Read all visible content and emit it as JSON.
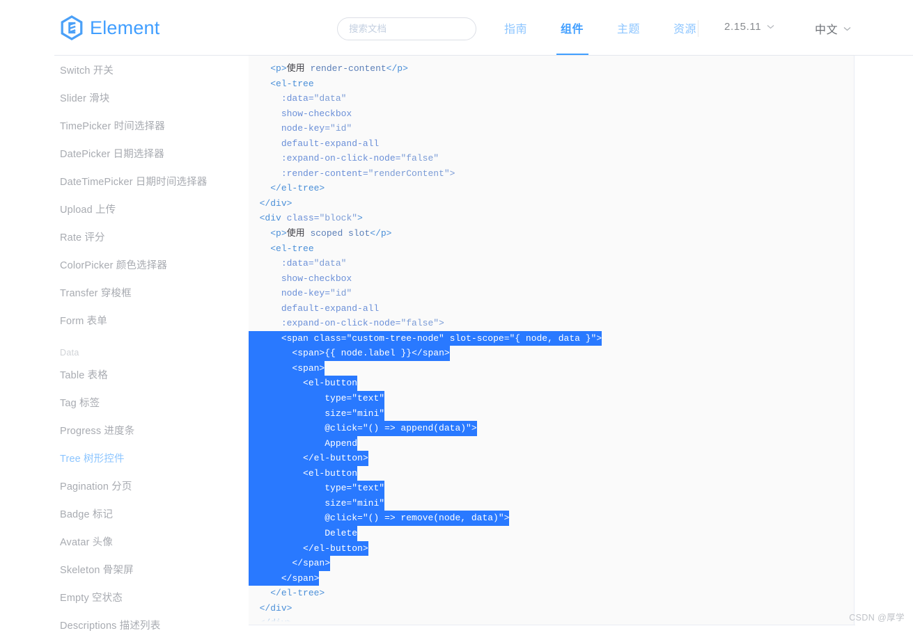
{
  "brand": {
    "name": "Element",
    "logo_icon": "element-hexagon-logo-icon",
    "accent_color": "#409eff"
  },
  "header": {
    "search": {
      "placeholder": "搜索文档",
      "value": "",
      "icon": "search-icon"
    },
    "nav": [
      {
        "label": "指南",
        "active": false
      },
      {
        "label": "组件",
        "active": true
      },
      {
        "label": "主题",
        "active": false
      },
      {
        "label": "资源",
        "active": false
      }
    ],
    "version": {
      "label": "2.15.11",
      "icon": "chevron-down-icon"
    },
    "language": {
      "label": "中文",
      "icon": "chevron-down-icon"
    }
  },
  "sidebar": {
    "items": [
      {
        "label": "Switch 开关",
        "type": "item",
        "active": false
      },
      {
        "label": "Slider 滑块",
        "type": "item",
        "active": false
      },
      {
        "label": "TimePicker 时间选择器",
        "type": "item",
        "active": false
      },
      {
        "label": "DatePicker 日期选择器",
        "type": "item",
        "active": false
      },
      {
        "label": "DateTimePicker 日期时间选择器",
        "type": "item",
        "active": false
      },
      {
        "label": "Upload 上传",
        "type": "item",
        "active": false
      },
      {
        "label": "Rate 评分",
        "type": "item",
        "active": false
      },
      {
        "label": "ColorPicker 颜色选择器",
        "type": "item",
        "active": false
      },
      {
        "label": "Transfer 穿梭框",
        "type": "item",
        "active": false
      },
      {
        "label": "Form 表单",
        "type": "item",
        "active": false
      },
      {
        "label": "Data",
        "type": "group",
        "active": false
      },
      {
        "label": "Table 表格",
        "type": "item",
        "active": false
      },
      {
        "label": "Tag 标签",
        "type": "item",
        "active": false
      },
      {
        "label": "Progress 进度条",
        "type": "item",
        "active": false
      },
      {
        "label": "Tree 树形控件",
        "type": "item",
        "active": true
      },
      {
        "label": "Pagination 分页",
        "type": "item",
        "active": false
      },
      {
        "label": "Badge 标记",
        "type": "item",
        "active": false
      },
      {
        "label": "Avatar 头像",
        "type": "item",
        "active": false
      },
      {
        "label": "Skeleton 骨架屏",
        "type": "item",
        "active": false
      },
      {
        "label": "Empty 空状态",
        "type": "item",
        "active": false
      },
      {
        "label": "Descriptions 描述列表",
        "type": "item",
        "active": false
      }
    ]
  },
  "code_block": {
    "language": "html",
    "selection_color": "#2979ff",
    "background": "#fafafa",
    "lines": [
      {
        "indent": 2,
        "selected": false,
        "tokens": [
          {
            "t": "tag",
            "s": "<p>"
          },
          {
            "t": "han",
            "s": "使用"
          },
          {
            "t": "han",
            "s": " "
          },
          {
            "t": "pln",
            "s": "render-content"
          },
          {
            "t": "tag",
            "s": "</p>"
          }
        ]
      },
      {
        "indent": 2,
        "selected": false,
        "tokens": [
          {
            "t": "tag",
            "s": "<el-tree"
          }
        ]
      },
      {
        "indent": 3,
        "selected": false,
        "tokens": [
          {
            "t": "attr",
            "s": ":data="
          },
          {
            "t": "val",
            "s": "\"data\""
          }
        ]
      },
      {
        "indent": 3,
        "selected": false,
        "tokens": [
          {
            "t": "attr",
            "s": "show-checkbox"
          }
        ]
      },
      {
        "indent": 3,
        "selected": false,
        "tokens": [
          {
            "t": "attr",
            "s": "node-key="
          },
          {
            "t": "val",
            "s": "\"id\""
          }
        ]
      },
      {
        "indent": 3,
        "selected": false,
        "tokens": [
          {
            "t": "attr",
            "s": "default-expand-all"
          }
        ]
      },
      {
        "indent": 3,
        "selected": false,
        "tokens": [
          {
            "t": "attr",
            "s": ":expand-on-click-node="
          },
          {
            "t": "val",
            "s": "\"false\""
          }
        ]
      },
      {
        "indent": 3,
        "selected": false,
        "tokens": [
          {
            "t": "attr",
            "s": ":render-content="
          },
          {
            "t": "val",
            "s": "\"renderContent\">"
          }
        ]
      },
      {
        "indent": 2,
        "selected": false,
        "tokens": [
          {
            "t": "tag",
            "s": "</el-tree>"
          }
        ]
      },
      {
        "indent": 1,
        "selected": false,
        "tokens": [
          {
            "t": "tag",
            "s": "</div>"
          }
        ]
      },
      {
        "indent": 1,
        "selected": false,
        "tokens": [
          {
            "t": "tag",
            "s": "<div "
          },
          {
            "t": "attr",
            "s": "class="
          },
          {
            "t": "val",
            "s": "\"block\""
          },
          {
            "t": "tag",
            "s": ">"
          }
        ]
      },
      {
        "indent": 2,
        "selected": false,
        "tokens": [
          {
            "t": "tag",
            "s": "<p>"
          },
          {
            "t": "han",
            "s": "使用"
          },
          {
            "t": "han",
            "s": " "
          },
          {
            "t": "pln",
            "s": "scoped slot"
          },
          {
            "t": "tag",
            "s": "</p>"
          }
        ]
      },
      {
        "indent": 2,
        "selected": false,
        "tokens": [
          {
            "t": "tag",
            "s": "<el-tree"
          }
        ]
      },
      {
        "indent": 3,
        "selected": false,
        "tokens": [
          {
            "t": "attr",
            "s": ":data="
          },
          {
            "t": "val",
            "s": "\"data\""
          }
        ]
      },
      {
        "indent": 3,
        "selected": false,
        "tokens": [
          {
            "t": "attr",
            "s": "show-checkbox"
          }
        ]
      },
      {
        "indent": 3,
        "selected": false,
        "tokens": [
          {
            "t": "attr",
            "s": "node-key="
          },
          {
            "t": "val",
            "s": "\"id\""
          }
        ]
      },
      {
        "indent": 3,
        "selected": false,
        "tokens": [
          {
            "t": "attr",
            "s": "default-expand-all"
          }
        ]
      },
      {
        "indent": 3,
        "selected": false,
        "tokens": [
          {
            "t": "attr",
            "s": ":expand-on-click-node="
          },
          {
            "t": "val",
            "s": "\"false\">"
          }
        ]
      },
      {
        "indent": 3,
        "selected": true,
        "first": true,
        "tokens": [
          {
            "t": "tag",
            "s": "<span "
          },
          {
            "t": "attr",
            "s": "class="
          },
          {
            "t": "val",
            "s": "\"custom-tree-node\""
          },
          {
            "t": "attr",
            "s": " slot-scope="
          },
          {
            "t": "val",
            "s": "\"{ node, data }\""
          },
          {
            "t": "tag",
            "s": ">"
          }
        ]
      },
      {
        "indent": 4,
        "selected": true,
        "tokens": [
          {
            "t": "tag",
            "s": "<span>"
          },
          {
            "t": "pln",
            "s": "{{ node.label }}"
          },
          {
            "t": "tag",
            "s": "</span>"
          }
        ]
      },
      {
        "indent": 4,
        "selected": true,
        "tokens": [
          {
            "t": "tag",
            "s": "<span>"
          }
        ]
      },
      {
        "indent": 5,
        "selected": true,
        "tokens": [
          {
            "t": "tag",
            "s": "<el-button"
          }
        ]
      },
      {
        "indent": 7,
        "selected": true,
        "tokens": [
          {
            "t": "attr",
            "s": "type="
          },
          {
            "t": "val",
            "s": "\"text\""
          }
        ]
      },
      {
        "indent": 7,
        "selected": true,
        "tokens": [
          {
            "t": "attr",
            "s": "size="
          },
          {
            "t": "val",
            "s": "\"mini\""
          }
        ]
      },
      {
        "indent": 7,
        "selected": true,
        "tokens": [
          {
            "t": "attr",
            "s": "@click="
          },
          {
            "t": "val",
            "s": "\"() => append(data)\""
          },
          {
            "t": "tag",
            "s": ">"
          }
        ]
      },
      {
        "indent": 7,
        "selected": true,
        "tokens": [
          {
            "t": "pln",
            "s": "Append"
          }
        ]
      },
      {
        "indent": 5,
        "selected": true,
        "tokens": [
          {
            "t": "tag",
            "s": "</el-button>"
          }
        ]
      },
      {
        "indent": 5,
        "selected": true,
        "tokens": [
          {
            "t": "tag",
            "s": "<el-button"
          }
        ]
      },
      {
        "indent": 7,
        "selected": true,
        "tokens": [
          {
            "t": "attr",
            "s": "type="
          },
          {
            "t": "val",
            "s": "\"text\""
          }
        ]
      },
      {
        "indent": 7,
        "selected": true,
        "tokens": [
          {
            "t": "attr",
            "s": "size="
          },
          {
            "t": "val",
            "s": "\"mini\""
          }
        ]
      },
      {
        "indent": 7,
        "selected": true,
        "tokens": [
          {
            "t": "attr",
            "s": "@click="
          },
          {
            "t": "val",
            "s": "\"() => remove(node, data)\""
          },
          {
            "t": "tag",
            "s": ">"
          }
        ]
      },
      {
        "indent": 7,
        "selected": true,
        "tokens": [
          {
            "t": "pln",
            "s": "Delete"
          }
        ]
      },
      {
        "indent": 5,
        "selected": true,
        "tokens": [
          {
            "t": "tag",
            "s": "</el-button>"
          }
        ]
      },
      {
        "indent": 4,
        "selected": true,
        "tokens": [
          {
            "t": "tag",
            "s": "</span>"
          }
        ]
      },
      {
        "indent": 3,
        "selected": true,
        "tokens": [
          {
            "t": "tag",
            "s": "</span>"
          }
        ]
      },
      {
        "indent": 2,
        "selected": false,
        "tokens": [
          {
            "t": "tag",
            "s": "</el-tree>"
          }
        ]
      },
      {
        "indent": 1,
        "selected": false,
        "tokens": [
          {
            "t": "tag",
            "s": "</div>"
          }
        ]
      },
      {
        "indent": 1,
        "selected": false,
        "tokens": [
          {
            "t": "tag",
            "s": "</div>"
          }
        ]
      }
    ]
  },
  "watermark": {
    "text": "CSDN @厚学"
  }
}
